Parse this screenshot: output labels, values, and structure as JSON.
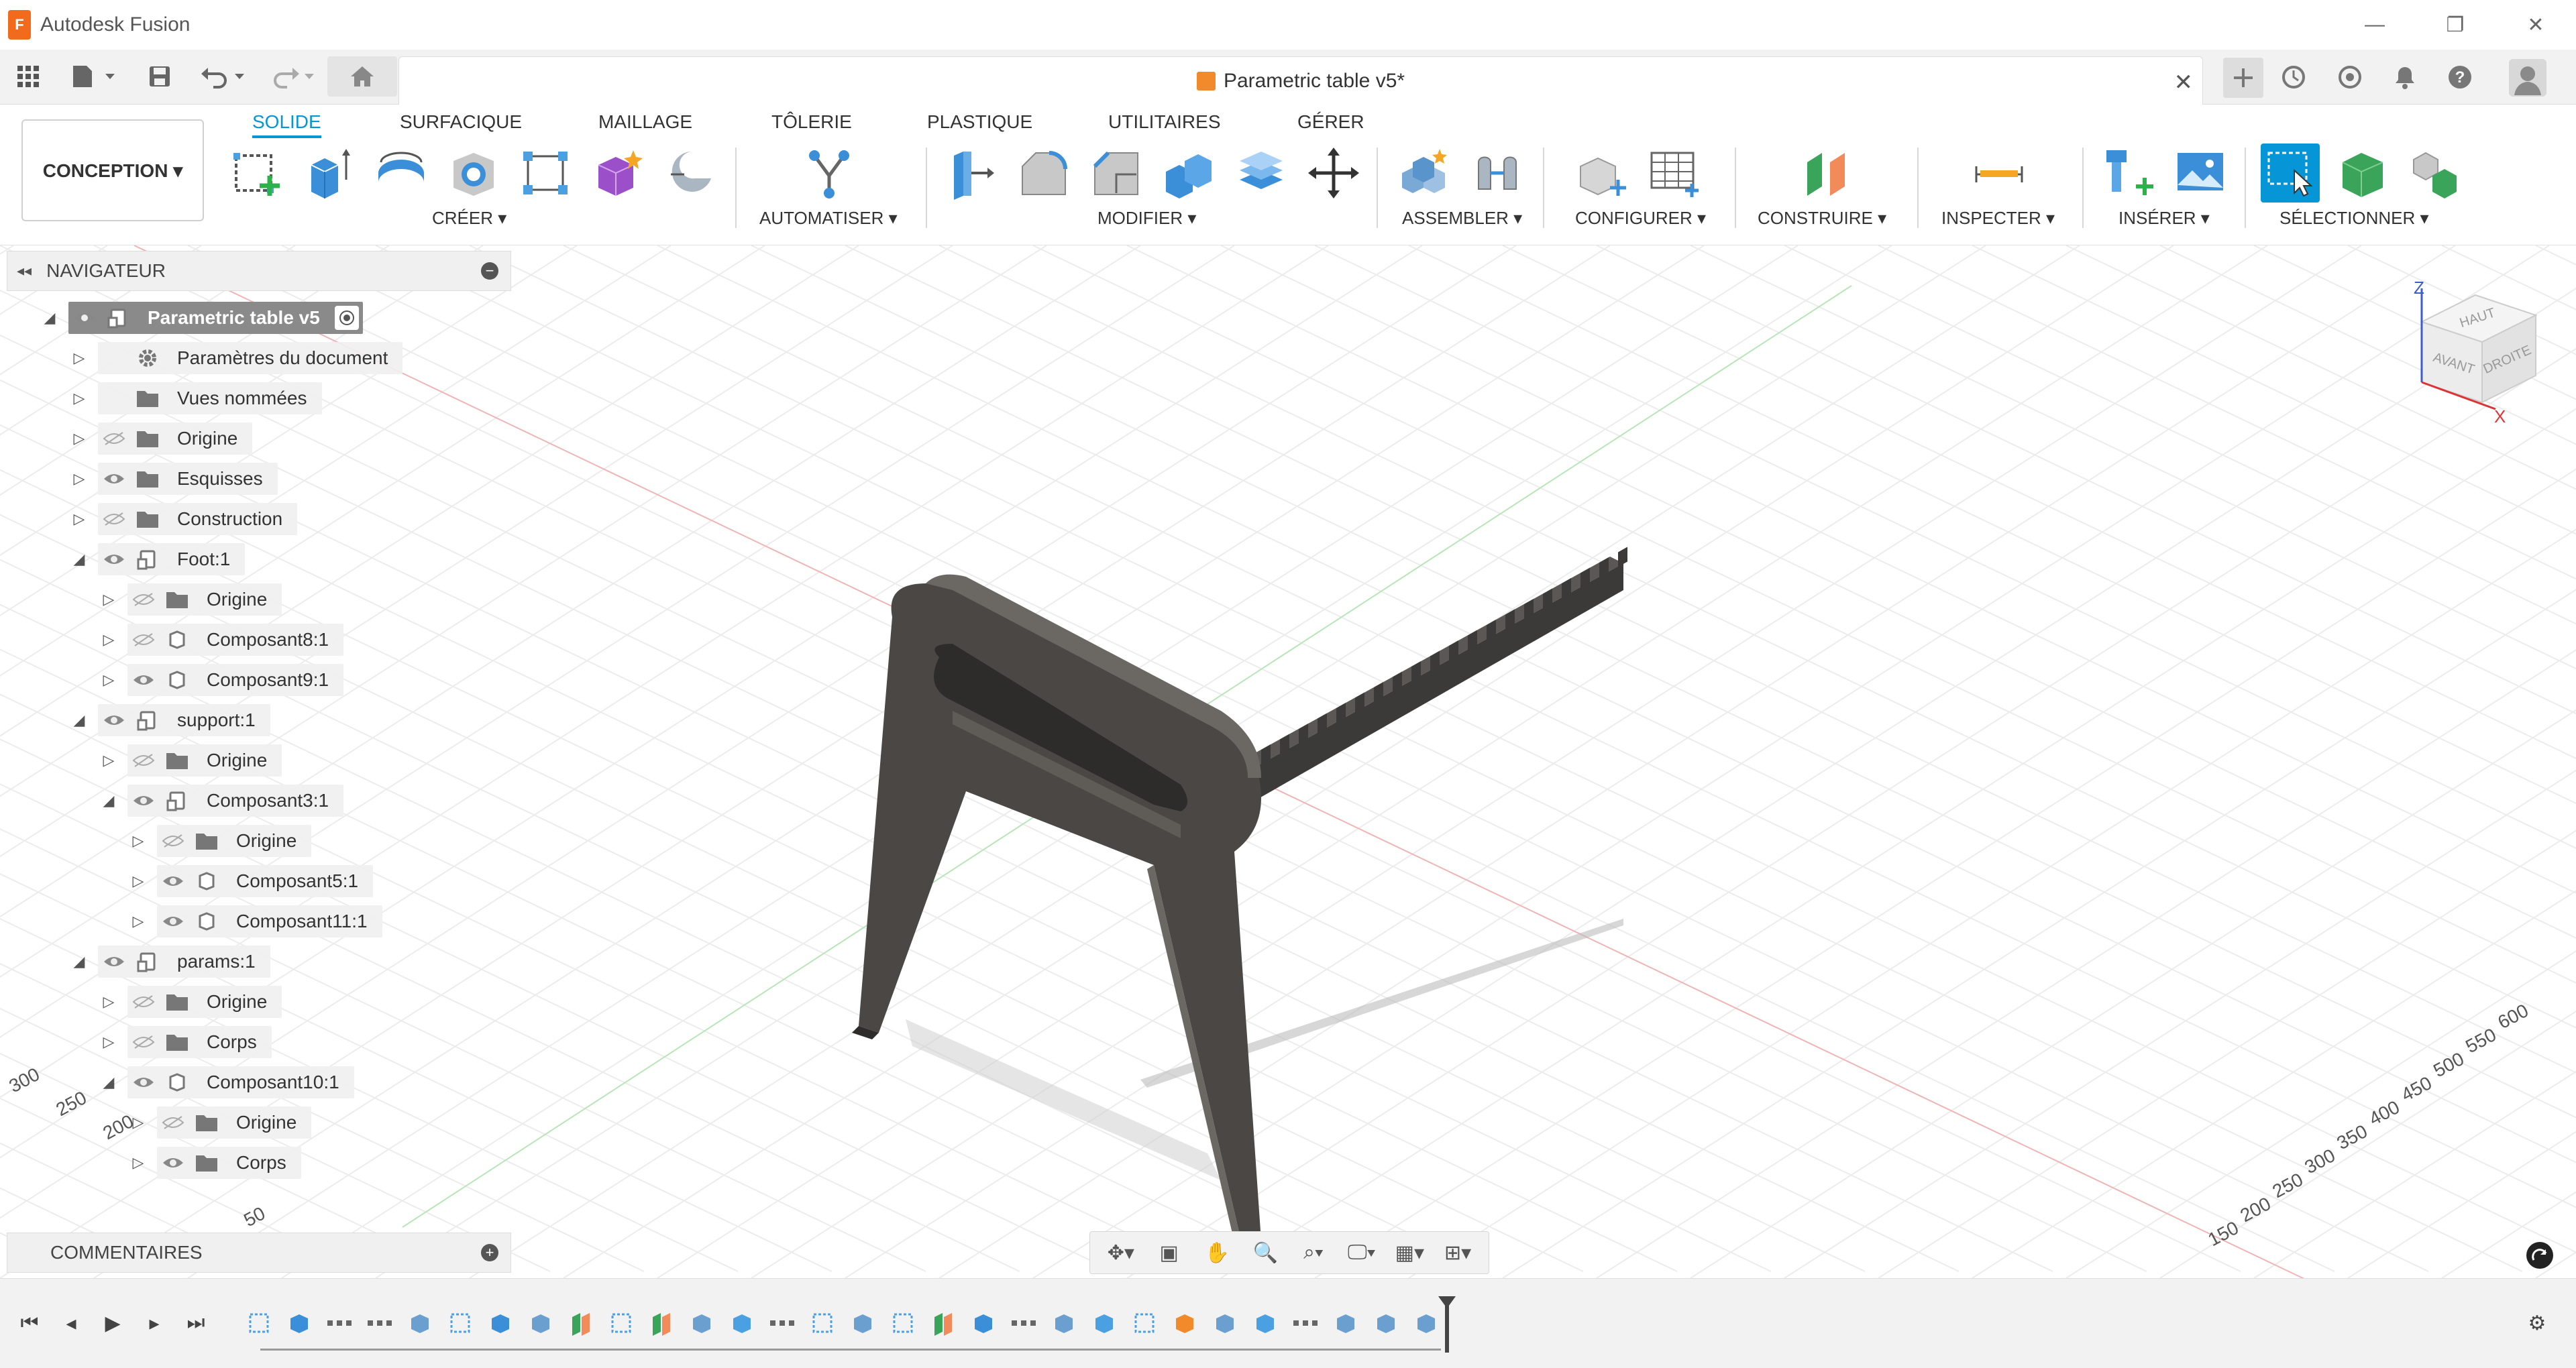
{
  "window": {
    "app_title": "Autodesk Fusion",
    "app_icon": "F",
    "minimize": "—",
    "restore": "❐",
    "close": "✕"
  },
  "document": {
    "tab_title": "Parametric table v5*",
    "close": "✕"
  },
  "workspace": {
    "label": "CONCEPTION ▾"
  },
  "ribbon": {
    "tabs": [
      {
        "label": "SOLIDE",
        "active": true
      },
      {
        "label": "SURFACIQUE"
      },
      {
        "label": "MAILLAGE"
      },
      {
        "label": "TÔLERIE"
      },
      {
        "label": "PLASTIQUE"
      },
      {
        "label": "UTILITAIRES"
      },
      {
        "label": "GÉRER"
      }
    ],
    "groups": {
      "create": "CRÉER ▾",
      "automate": "AUTOMATISER ▾",
      "modify": "MODIFIER ▾",
      "assemble": "ASSEMBLER ▾",
      "configure": "CONFIGURER ▾",
      "construct": "CONSTRUIRE ▾",
      "inspect": "INSPECTER ▾",
      "insert": "INSÉRER ▾",
      "select": "SÉLECTIONNER ▾"
    }
  },
  "navigator": {
    "title": "NAVIGATEUR",
    "collapse": "◂◂",
    "minus": "−",
    "items": [
      {
        "label": "Parametric table v5",
        "level": 0,
        "expand": "◢",
        "eye": true,
        "icon": "component"
      },
      {
        "label": "Paramètres du document",
        "level": 1,
        "expand": "▷",
        "eye": null,
        "icon": "gear"
      },
      {
        "label": "Vues nommées",
        "level": 1,
        "expand": "▷",
        "eye": null,
        "icon": "folder"
      },
      {
        "label": "Origine",
        "level": 1,
        "expand": "▷",
        "eye": false,
        "icon": "folder"
      },
      {
        "label": "Esquisses",
        "level": 1,
        "expand": "▷",
        "eye": true,
        "icon": "folder"
      },
      {
        "label": "Construction",
        "level": 1,
        "expand": "▷",
        "eye": false,
        "icon": "folder"
      },
      {
        "label": "Foot:1",
        "level": 1,
        "expand": "◢",
        "eye": true,
        "icon": "component"
      },
      {
        "label": "Origine",
        "level": 2,
        "expand": "▷",
        "eye": false,
        "icon": "folder"
      },
      {
        "label": "Composant8:1",
        "level": 2,
        "expand": "▷",
        "eye": false,
        "icon": "body"
      },
      {
        "label": "Composant9:1",
        "level": 2,
        "expand": "▷",
        "eye": true,
        "icon": "body"
      },
      {
        "label": "support:1",
        "level": 1,
        "expand": "◢",
        "eye": true,
        "icon": "component"
      },
      {
        "label": "Origine",
        "level": 2,
        "expand": "▷",
        "eye": false,
        "icon": "folder"
      },
      {
        "label": "Composant3:1",
        "level": 2,
        "expand": "◢",
        "eye": true,
        "icon": "component"
      },
      {
        "label": "Origine",
        "level": 3,
        "expand": "▷",
        "eye": false,
        "icon": "folder"
      },
      {
        "label": "Composant5:1",
        "level": 3,
        "expand": "▷",
        "eye": true,
        "icon": "body"
      },
      {
        "label": "Composant11:1",
        "level": 3,
        "expand": "▷",
        "eye": true,
        "icon": "body"
      },
      {
        "label": "params:1",
        "level": 1,
        "expand": "◢",
        "eye": true,
        "icon": "component"
      },
      {
        "label": "Origine",
        "level": 2,
        "expand": "▷",
        "eye": false,
        "icon": "folder"
      },
      {
        "label": "Corps",
        "level": 2,
        "expand": "▷",
        "eye": false,
        "icon": "folder"
      },
      {
        "label": "Composant10:1",
        "level": 2,
        "expand": "◢",
        "eye": true,
        "icon": "body"
      },
      {
        "label": "Origine",
        "level": 3,
        "expand": "▷",
        "eye": false,
        "icon": "folder"
      },
      {
        "label": "Corps",
        "level": 3,
        "expand": "▷",
        "eye": true,
        "icon": "folder"
      }
    ]
  },
  "comments": {
    "title": "COMMENTAIRES",
    "plus": "+"
  },
  "viewcube": {
    "top": "HAUT",
    "front": "AVANT",
    "right": "DROITE",
    "axis_z": "Z",
    "axis_x": "X"
  },
  "grid_labels": {
    "right": [
      "600",
      "550",
      "500",
      "450",
      "400",
      "350",
      "300",
      "250",
      "200",
      "150"
    ],
    "left": [
      "300",
      "250",
      "200",
      "50"
    ]
  },
  "colors": {
    "accent": "#0696d7",
    "part": "#4a4744",
    "grid": "#e4e4e4"
  }
}
